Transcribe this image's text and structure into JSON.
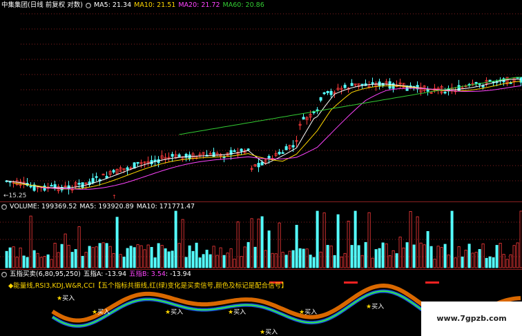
{
  "price_header": {
    "title": "中集集团(日线 前复权 对数)",
    "ma5": "MA5: 21.34",
    "ma10": "MA10: 21.51",
    "ma20": "MA20: 21.72",
    "ma60": "MA60: 20.86"
  },
  "price_low_label": "←15.25",
  "volume_header": {
    "volume": "VOLUME: 199369.52",
    "ma5": "MA5: 193920.89",
    "ma10": "MA10: 171771.47"
  },
  "indicator_header": {
    "name": "五指买卖(6,80,95,250)",
    "a": "五指A: -13.94",
    "b_label": "五指B: 3.54",
    "b_value": ": -13.94"
  },
  "indicator_desc": "◆能量线,RSI3,KDJ,W&R,CCI【五个指标共振线,红(绿)变化是买卖信号,颜色及标记是配合信号】",
  "buy_label": "买入",
  "buy_star": "★",
  "watermark": "www.7gpzb.com",
  "colors": {
    "up": "#ff3b3b",
    "down": "#54ffff",
    "ma5": "#ffffff",
    "ma10": "#ffd700",
    "ma20": "#ff44ff",
    "ma60": "#33cc33",
    "grid": "#8a2020"
  }
}
